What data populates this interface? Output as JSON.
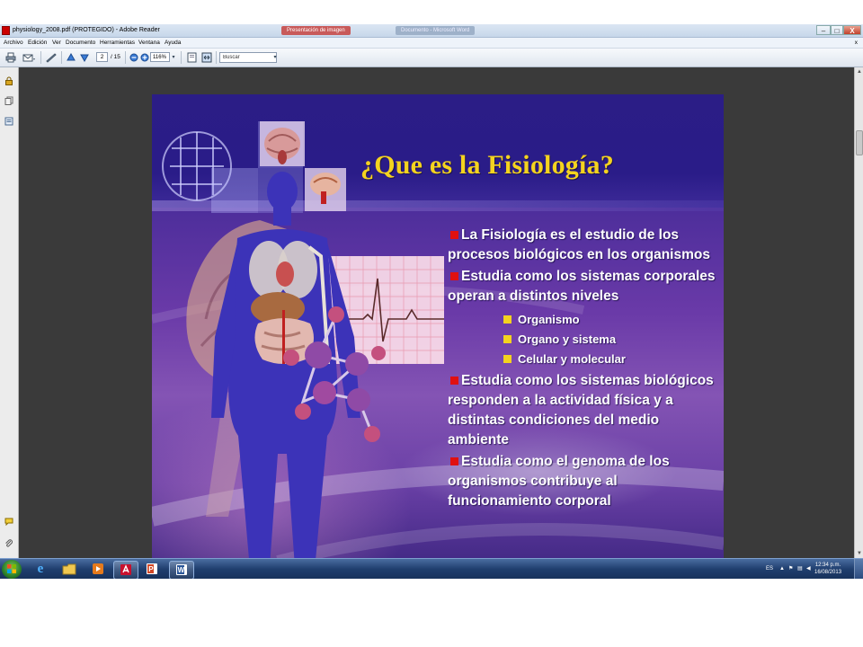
{
  "window": {
    "title": "physiology_2008.pdf (PROTEGIDO) - Adobe Reader",
    "background_tabs": [
      "Presentación de imagen",
      "Documento - Microsoft Word"
    ],
    "controls": {
      "minimize": "–",
      "maximize": "□",
      "close": "X"
    }
  },
  "menu": {
    "items": [
      "Archivo",
      "Edición",
      "Ver",
      "Documento",
      "Herramientas",
      "Ventana",
      "Ayuda"
    ],
    "close_glyph": "x"
  },
  "toolbar": {
    "current_page": "2",
    "page_total": "/ 15",
    "zoom": "116%",
    "search_placeholder": "Buscar"
  },
  "slide": {
    "title": "¿Que es la Fisiología?",
    "bullets": [
      "La Fisiología es el estudio de los procesos biológicos en los organismos",
      "Estudia como los sistemas corporales operan a distintos niveles"
    ],
    "sub_bullets": [
      "Organismo",
      "Organo y sistema",
      "Celular y molecular"
    ],
    "bullets_after": [
      "Estudia como los sistemas biológicos responden a la actividad física y a distintas condiciones del medio ambiente",
      "Estudia como el genoma de los organismos contribuye al funcionamiento corporal"
    ]
  },
  "taskbar": {
    "language": "ES",
    "time": "12:34 p.m.",
    "date": "16/08/2013"
  },
  "colors": {
    "title_yellow": "#f4d31f",
    "bullet_red": "#e01010",
    "slide_purple": "#2b1d86"
  }
}
